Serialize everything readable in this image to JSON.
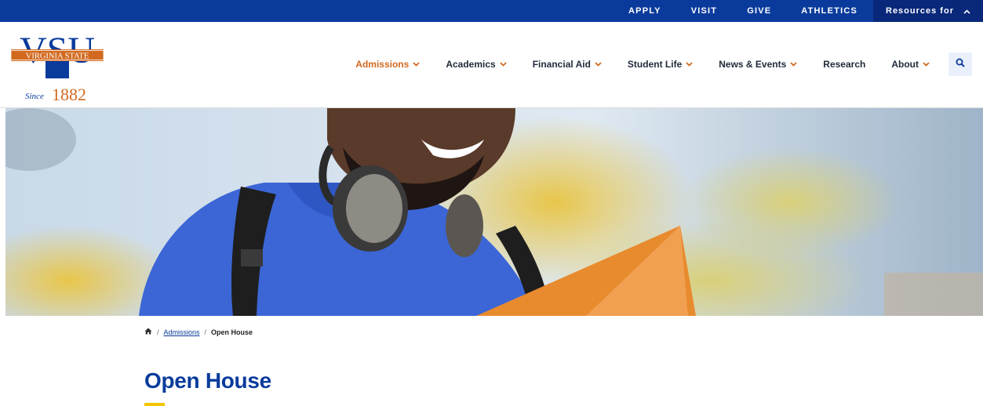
{
  "topbar": {
    "links": [
      "APPLY",
      "VISIT",
      "GIVE",
      "ATHLETICS"
    ],
    "resources_label": "Resources for"
  },
  "logo": {
    "letters": "VSU",
    "banner": "VIRGINIA STATE",
    "since_script": "Since",
    "year": "1882"
  },
  "nav": {
    "items": [
      {
        "label": "Admissions",
        "dropdown": true,
        "active": true
      },
      {
        "label": "Academics",
        "dropdown": true
      },
      {
        "label": "Financial Aid",
        "dropdown": true
      },
      {
        "label": "Student Life",
        "dropdown": true
      },
      {
        "label": "News & Events",
        "dropdown": true
      },
      {
        "label": "Research",
        "dropdown": false
      },
      {
        "label": "About",
        "dropdown": true
      }
    ],
    "search_icon": "search-icon"
  },
  "breadcrumb": {
    "home_icon": "home-icon",
    "separator": "/",
    "parent": "Admissions",
    "current": "Open House"
  },
  "page": {
    "title": "Open House"
  },
  "colors": {
    "brand_blue": "#0a3b9c",
    "brand_blue_dark": "#09287a",
    "brand_orange": "#d2691e",
    "accent_yellow": "#f5c400"
  }
}
